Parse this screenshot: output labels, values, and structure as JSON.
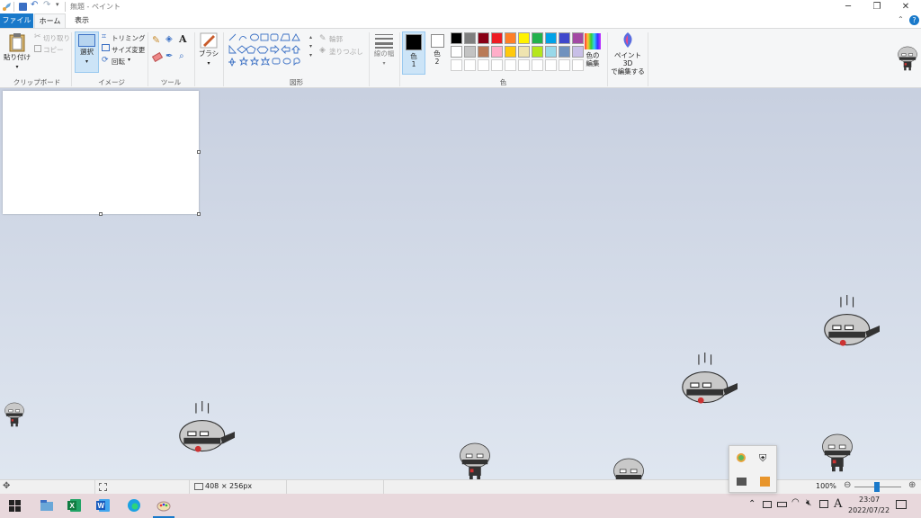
{
  "titlebar": {
    "document_title": "無題 - ペイント",
    "minimize": "─",
    "restore": "❐",
    "close": "✕"
  },
  "tabs": {
    "file": "ファイル",
    "home": "ホーム",
    "view": "表示"
  },
  "ribbon": {
    "clipboard": {
      "paste": "貼り付け",
      "cut": "切り取り",
      "copy": "コピー",
      "group": "クリップボード"
    },
    "image": {
      "select": "選択",
      "crop": "トリミング",
      "resize": "サイズ変更",
      "rotate": "回転",
      "group": "イメージ"
    },
    "tools": {
      "group": "ツール"
    },
    "brushes": {
      "label": "ブラシ"
    },
    "shapes": {
      "outline": "輪郭",
      "fill": "塗りつぶし",
      "group": "図形"
    },
    "size": {
      "label": "線の幅"
    },
    "colors": {
      "color1": "色\n1",
      "color2": "色\n2",
      "edit": "色の\n編集",
      "group": "色",
      "palette": [
        "#000000",
        "#7f7f7f",
        "#880015",
        "#ed1c24",
        "#ff7f27",
        "#fff200",
        "#22b14c",
        "#00a2e8",
        "#3f48cc",
        "#a349a4",
        "#ffffff",
        "#c3c3c3",
        "#b97a57",
        "#ffaec9",
        "#ffc90e",
        "#efe4b0",
        "#b5e61d",
        "#99d9ea",
        "#7092be",
        "#c8bfe7"
      ]
    },
    "paint3d": {
      "label": "ペイント 3D\nで編集する"
    }
  },
  "statusbar": {
    "image_size": "408 × 256px",
    "zoom": "100%"
  },
  "taskbar": {
    "time": "23:07",
    "date": "2022/07/22",
    "ime": "A"
  }
}
